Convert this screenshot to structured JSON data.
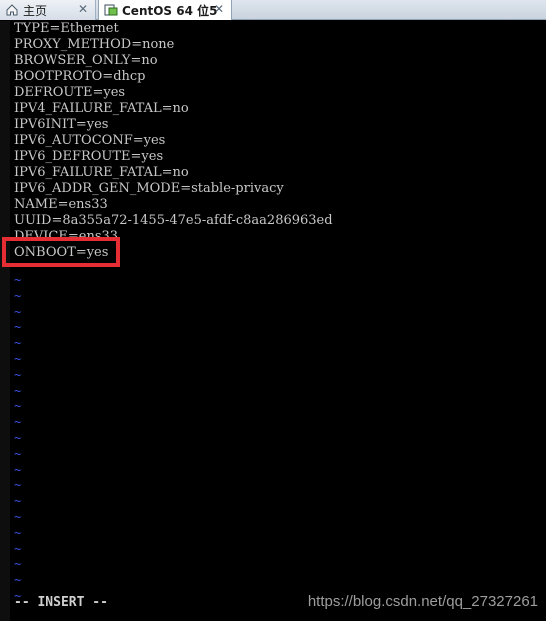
{
  "tabs": [
    {
      "label": "主页",
      "icon": "home-icon",
      "active": false
    },
    {
      "label": "CentOS 64 位5",
      "icon": "vm-icon",
      "active": true
    }
  ],
  "tab_close_glyph": "✕",
  "editor": {
    "lines": [
      "TYPE=Ethernet",
      "PROXY_METHOD=none",
      "BROWSER_ONLY=no",
      "BOOTPROTO=dhcp",
      "DEFROUTE=yes",
      "IPV4_FAILURE_FATAL=no",
      "IPV6INIT=yes",
      "IPV6_AUTOCONF=yes",
      "IPV6_DEFROUTE=yes",
      "IPV6_FAILURE_FATAL=no",
      "IPV6_ADDR_GEN_MODE=stable-privacy",
      "NAME=ens33",
      "UUID=8a355a72-1455-47e5-afdf-c8aa286963ed",
      "DEVICE=ens33",
      "ONBOOT=yes"
    ],
    "empty_line_marker": "~",
    "empty_line_count": 21,
    "mode_status": "-- INSERT --",
    "highlight_color": "#e62d33",
    "tilde_color": "#3a52e0"
  },
  "watermark": "https://blog.csdn.net/qq_27327261"
}
